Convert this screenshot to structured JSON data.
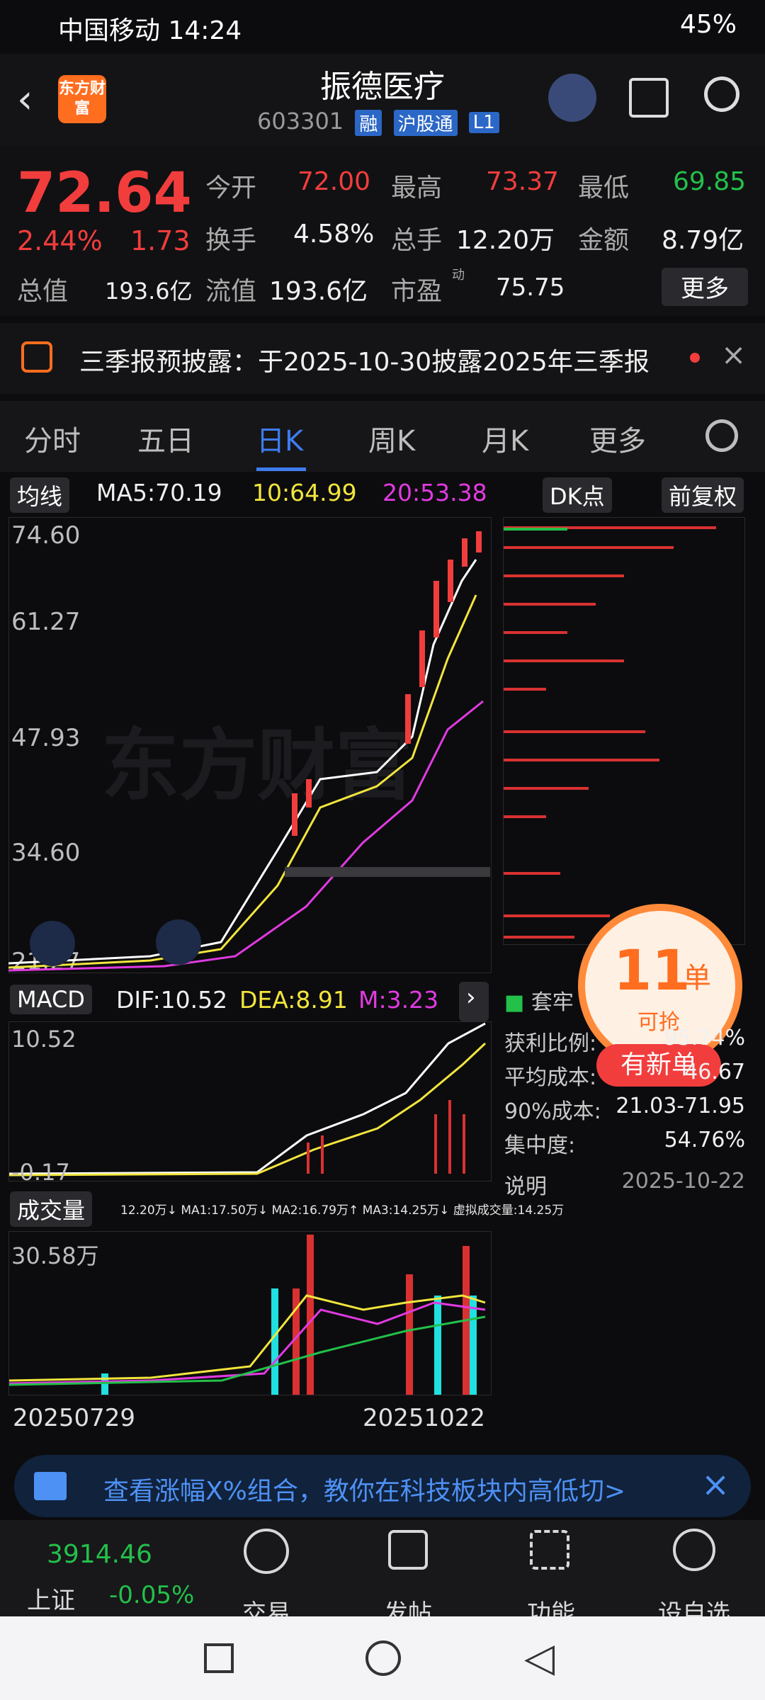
{
  "status_bar": {
    "carrier_time": "中国移动 14:24",
    "battery": "45%"
  },
  "header": {
    "back_icon": "back-arrow-icon",
    "logo": "东方财富",
    "title": "振德医疗",
    "code": "603301",
    "tags": [
      "融",
      "沪股通",
      "L1"
    ],
    "share_icon": "share-icon",
    "search_icon": "search-icon"
  },
  "quote": {
    "price": "72.64",
    "change_pct": "2.44%",
    "change": "1.73",
    "open_label": "今开",
    "open": "72.00",
    "high_label": "最高",
    "high": "73.37",
    "low_label": "最低",
    "low": "69.85",
    "turnover_label": "换手",
    "turnover": "4.58%",
    "volume_label": "总手",
    "volume": "12.20万",
    "amount_label": "金额",
    "amount": "8.79亿",
    "mktcap_label": "总值",
    "mktcap": "193.6亿",
    "float_label": "流值",
    "float": "193.6亿",
    "pe_label": "市盈",
    "pe_sup": "动",
    "pe": "75.75",
    "more": "更多"
  },
  "notice": {
    "text": "三季报预披露：于2025-10-30披露2025年三季报"
  },
  "tabs": [
    "分时",
    "五日",
    "日K",
    "周K",
    "月K",
    "更多"
  ],
  "active_tab": "日K",
  "ma_bar": {
    "label": "均线",
    "ma5": "MA5:70.19",
    "ma10": "10:64.99",
    "ma20": "20:53.38",
    "dk": "DK点",
    "fq": "前复权"
  },
  "price_axis": [
    "74.60",
    "61.27",
    "47.93",
    "34.60",
    "21.27"
  ],
  "watermark": "东方财富",
  "macd_bar": {
    "label": "MACD",
    "dif": "DIF:10.52",
    "dea": "DEA:8.91",
    "m": "M:3.23"
  },
  "macd_axis": [
    "10.52",
    "-0.17"
  ],
  "vol_bar": {
    "label": "成交量",
    "info": "12.20万↓ MA1:17.50万↓ MA2:16.79万↑ MA3:14.25万↓ 虚拟成交量:14.25万"
  },
  "vol_axis": "30.58万",
  "dates": [
    "20250729",
    "20251022"
  ],
  "chip": {
    "title": "套牢",
    "rows": [
      {
        "k": "获利比例:",
        "v": "95.74%"
      },
      {
        "k": "平均成本:",
        "v": "46.67"
      },
      {
        "k": "90%成本:",
        "v": "21.03-71.95"
      },
      {
        "k": "集中度:",
        "v": "54.76%"
      }
    ],
    "note": "说明",
    "date": "2025-10-22"
  },
  "promo": {
    "num": "11",
    "unit": "单",
    "sub": "可抢",
    "btn": "有新单"
  },
  "banner": {
    "text": "查看涨幅X%组合，教你在科技板块内高低切>"
  },
  "index": {
    "value": "3914.46",
    "name": "上证",
    "pct": "-0.05%"
  },
  "tabbar": [
    "交易",
    "发帖",
    "功能",
    "设自选"
  ],
  "colors": {
    "up": "#f23d3d",
    "down": "#23c04a",
    "accent": "#3e7cf0",
    "orange": "#ff6d1f"
  }
}
